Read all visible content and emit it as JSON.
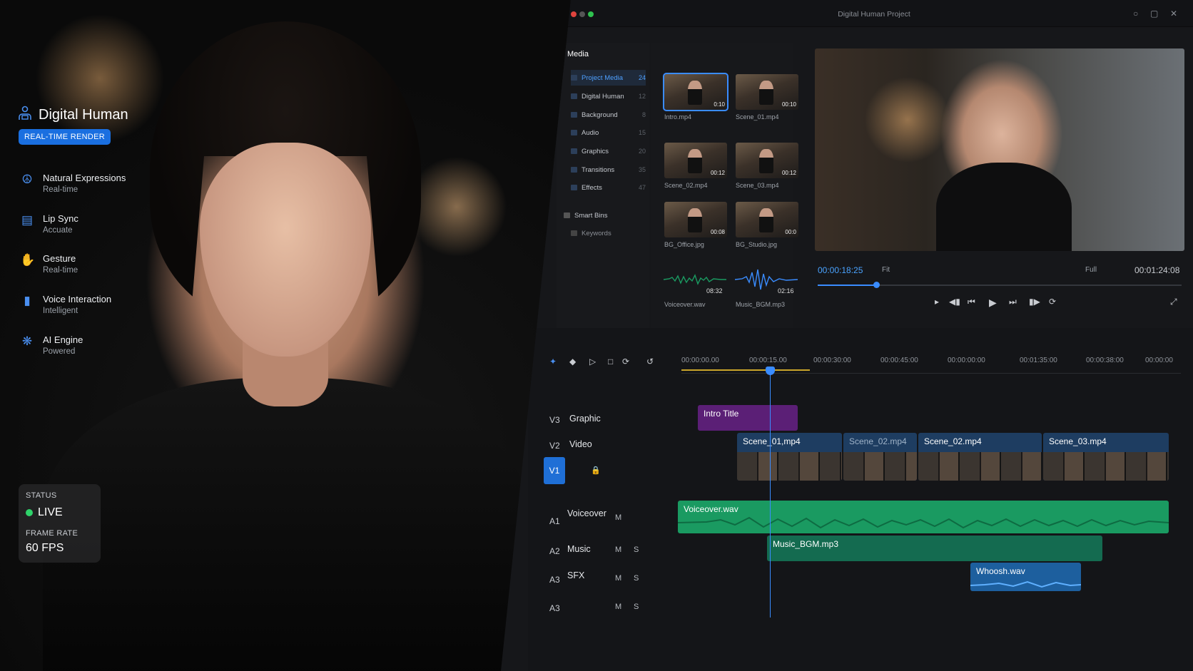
{
  "hero": {
    "brand": "Digital Human",
    "badge": "REAL-TIME RENDER",
    "features": [
      {
        "icon": "person-network-icon",
        "title": "Natural Expressions",
        "sub": "Real-time"
      },
      {
        "icon": "lip-sync-icon",
        "title": "Lip Sync",
        "sub": "Accuate"
      },
      {
        "icon": "gesture-icon",
        "title": "Gesture",
        "sub": "Real-time"
      },
      {
        "icon": "voice-wave-icon",
        "title": "Voice Interaction",
        "sub": "Intelligent"
      },
      {
        "icon": "ai-engine-icon",
        "title": "AI Engine",
        "sub": "Powered"
      }
    ],
    "status_label": "STATUS",
    "status_value": "LIVE",
    "framerate_label": "FRAME RATE",
    "framerate_value": "60 FPS"
  },
  "window": {
    "title": "Digital Human Project"
  },
  "media": {
    "header": "Media",
    "folders": [
      {
        "name": "Project Media",
        "count": "24",
        "selected": true
      },
      {
        "name": "Digital Human",
        "count": "12"
      },
      {
        "name": "Background",
        "count": "8"
      },
      {
        "name": "Audio",
        "count": "15"
      },
      {
        "name": "Graphics",
        "count": "20"
      },
      {
        "name": "Transitions",
        "count": "35"
      },
      {
        "name": "Effects",
        "count": "47"
      }
    ],
    "smart_bins": "Smart Bins",
    "keywords": "Keywords",
    "items": [
      {
        "name": "Intro.mp4",
        "dur": "0:10",
        "selected": true
      },
      {
        "name": "Scene_01.mp4",
        "dur": "00:10"
      },
      {
        "name": "Scene_02.mp4",
        "dur": "00:12"
      },
      {
        "name": "Scene_03.mp4",
        "dur": "00:12"
      },
      {
        "name": "BG_Office.jpg",
        "dur": "00:08"
      },
      {
        "name": "BG_Studio.jpg",
        "dur": "00:0"
      },
      {
        "name": "Voiceover.wav",
        "dur": "08:32"
      },
      {
        "name": "Music_BGM.mp3",
        "dur": "02:16"
      }
    ]
  },
  "preview": {
    "timecode": "00:00:18:25",
    "fit": "Fit",
    "quality": "Full",
    "duration": "00:01:24:08",
    "progress": 0.16
  },
  "timeline": {
    "ruler": [
      "00:00:00.00",
      "00:00:15.00",
      "00:00:30:00",
      "00:00:45:00",
      "00:00:00:00",
      "00:01:35:00",
      "00:00:38:00",
      "00:00:00"
    ],
    "tracks": {
      "v3": {
        "id": "V3",
        "name": "Graphic"
      },
      "v2": {
        "id": "V2",
        "name": "Video"
      },
      "v1": {
        "id": "V1"
      },
      "a1": {
        "id": "A1",
        "name": "Voiceover"
      },
      "a2": {
        "id": "A2",
        "name": "Music"
      },
      "a3": {
        "id": "A3",
        "name": "SFX"
      },
      "a3b": {
        "id": "A3"
      }
    },
    "mute": "M",
    "solo": "S",
    "clips": {
      "intro_title": "Intro Title",
      "scene_01": "Scene_01,mp4",
      "scene_02a": "Scene_02.mp4",
      "scene_02b": "Scene_02.mp4",
      "scene_03": "Scene_03.mp4",
      "voiceover": "Voiceover.wav",
      "music": "Music_BGM.mp3",
      "whoosh": "Whoosh.wav"
    }
  },
  "colors": {
    "accent": "#3a8cff",
    "live": "#2fd36a",
    "title_clip": "#5b1f76",
    "audio_clip": "#1a9a61"
  }
}
